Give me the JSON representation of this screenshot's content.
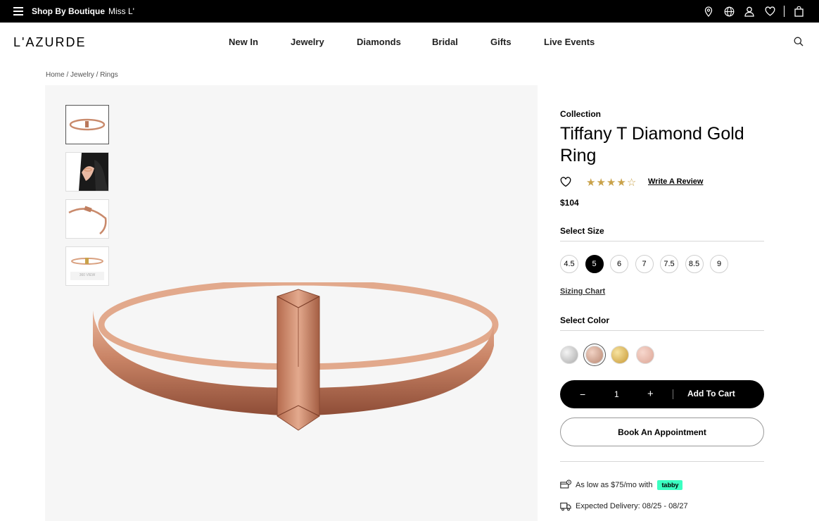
{
  "topbar": {
    "shop_label": "Shop By Boutique",
    "miss_label": "Miss L'",
    "icons": [
      "location-icon",
      "globe-icon",
      "user-icon",
      "heart-icon",
      "bag-icon"
    ]
  },
  "header": {
    "logo": "L'AZURDE",
    "nav": [
      "New In",
      "Jewelry",
      "Diamonds",
      "Bridal",
      "Gifts",
      "Live Events"
    ]
  },
  "breadcrumb": "Home / Jewelry / Rings",
  "gallery": {
    "thumb4_label": "360 VIEW"
  },
  "product": {
    "collection": "Collection",
    "title": "Tiffany T Diamond Gold Ring",
    "rating": 4,
    "rating_max": 5,
    "review_link": "Write A Review",
    "price": "$104",
    "size_label": "Select Size",
    "sizes": [
      "4.5",
      "5",
      "6",
      "7",
      "7.5",
      "8.5",
      "9"
    ],
    "selected_size": "5",
    "sizing_chart": "Sizing Chart",
    "color_label": "Select Color",
    "colors": [
      "#c8c8c8",
      "#c9a08e",
      "#d8ae4e",
      "#e6b3a6"
    ],
    "selected_color_index": 1,
    "quantity": "1",
    "minus": "−",
    "plus": "+",
    "add_to_cart": "Add To Cart",
    "book_appointment": "Book An Appointment",
    "installment_text": "As low as $75/mo with",
    "tabby_label": "tabby",
    "delivery_text": "Expected Delivery: 08/25 - 08/27"
  },
  "colors": {
    "rose_gold": "#c98a6c",
    "star": "#c9a24a",
    "tabby": "#3bffc1"
  }
}
